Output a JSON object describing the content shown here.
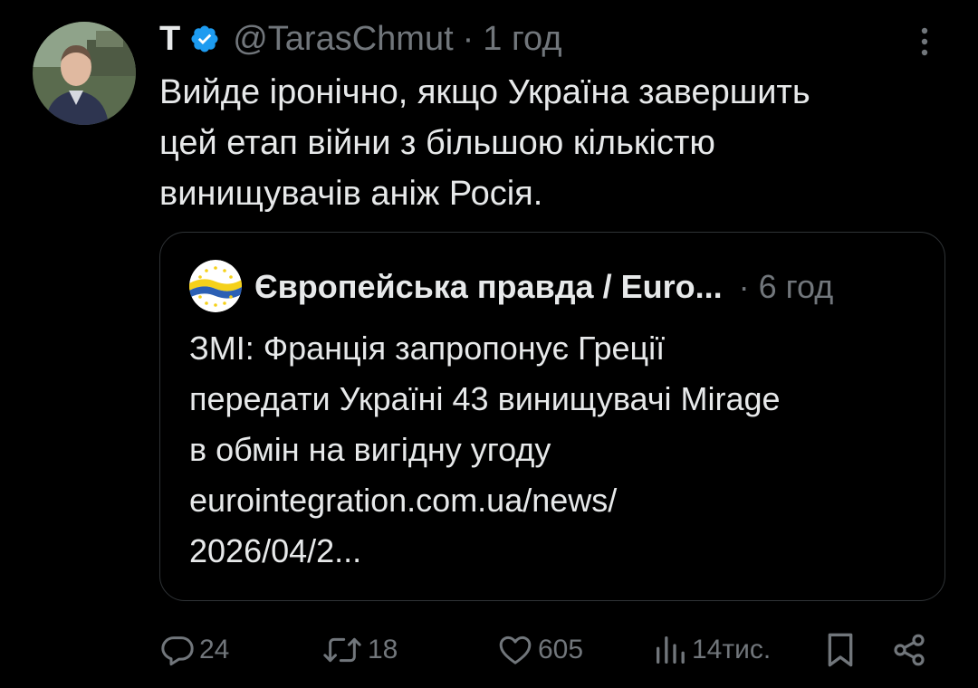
{
  "tweet": {
    "author": {
      "display_name": "T",
      "handle": "@TarasChmut",
      "verified": true,
      "avatar_icon": "profile-photo"
    },
    "separator": "·",
    "time": "1 год",
    "text_lines": [
      "Вийде іронічно, якщо Україна завершить",
      "цей етап війни з більшою кількістю",
      "винищувачів аніж Росія."
    ],
    "more_icon": "more-vertical-icon"
  },
  "quote": {
    "author": {
      "display_name": "Європейська правда / Euro...",
      "avatar_icon": "eu-flag-logo"
    },
    "separator": "·",
    "time": "6 год",
    "text_lines": [
      "ЗМІ: Франція запропонує Греції",
      "передати Україні 43 винищувачі Mirage",
      "в обмін на вигідну угоду",
      "eurointegration.com.ua/news/",
      "2026/04/2..."
    ]
  },
  "actions": {
    "reply": {
      "icon": "reply-icon",
      "count": "24"
    },
    "repost": {
      "icon": "repost-icon",
      "count": "18"
    },
    "like": {
      "icon": "heart-icon",
      "count": "605"
    },
    "views": {
      "icon": "views-icon",
      "count": "14тис."
    },
    "bookmark": {
      "icon": "bookmark-icon"
    },
    "share": {
      "icon": "share-icon"
    }
  },
  "colors": {
    "background": "#000000",
    "text_primary": "#e7e9ea",
    "text_secondary": "#71767b",
    "border": "#2f3336",
    "verified_blue": "#1d9bf0"
  }
}
